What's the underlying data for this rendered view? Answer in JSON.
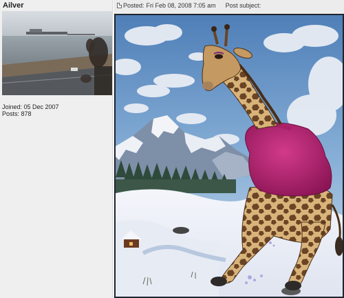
{
  "author": {
    "username": "Ailver",
    "joined": "Joined: 05 Dec 2007",
    "posts": "Posts: 878"
  },
  "post": {
    "posted_label": "Posted:",
    "posted_date": "Fri Feb 08, 2008 7:05 am",
    "subject_label": "Post subject:",
    "subject_value": ""
  },
  "icons": {
    "post_icon": "document-icon"
  }
}
